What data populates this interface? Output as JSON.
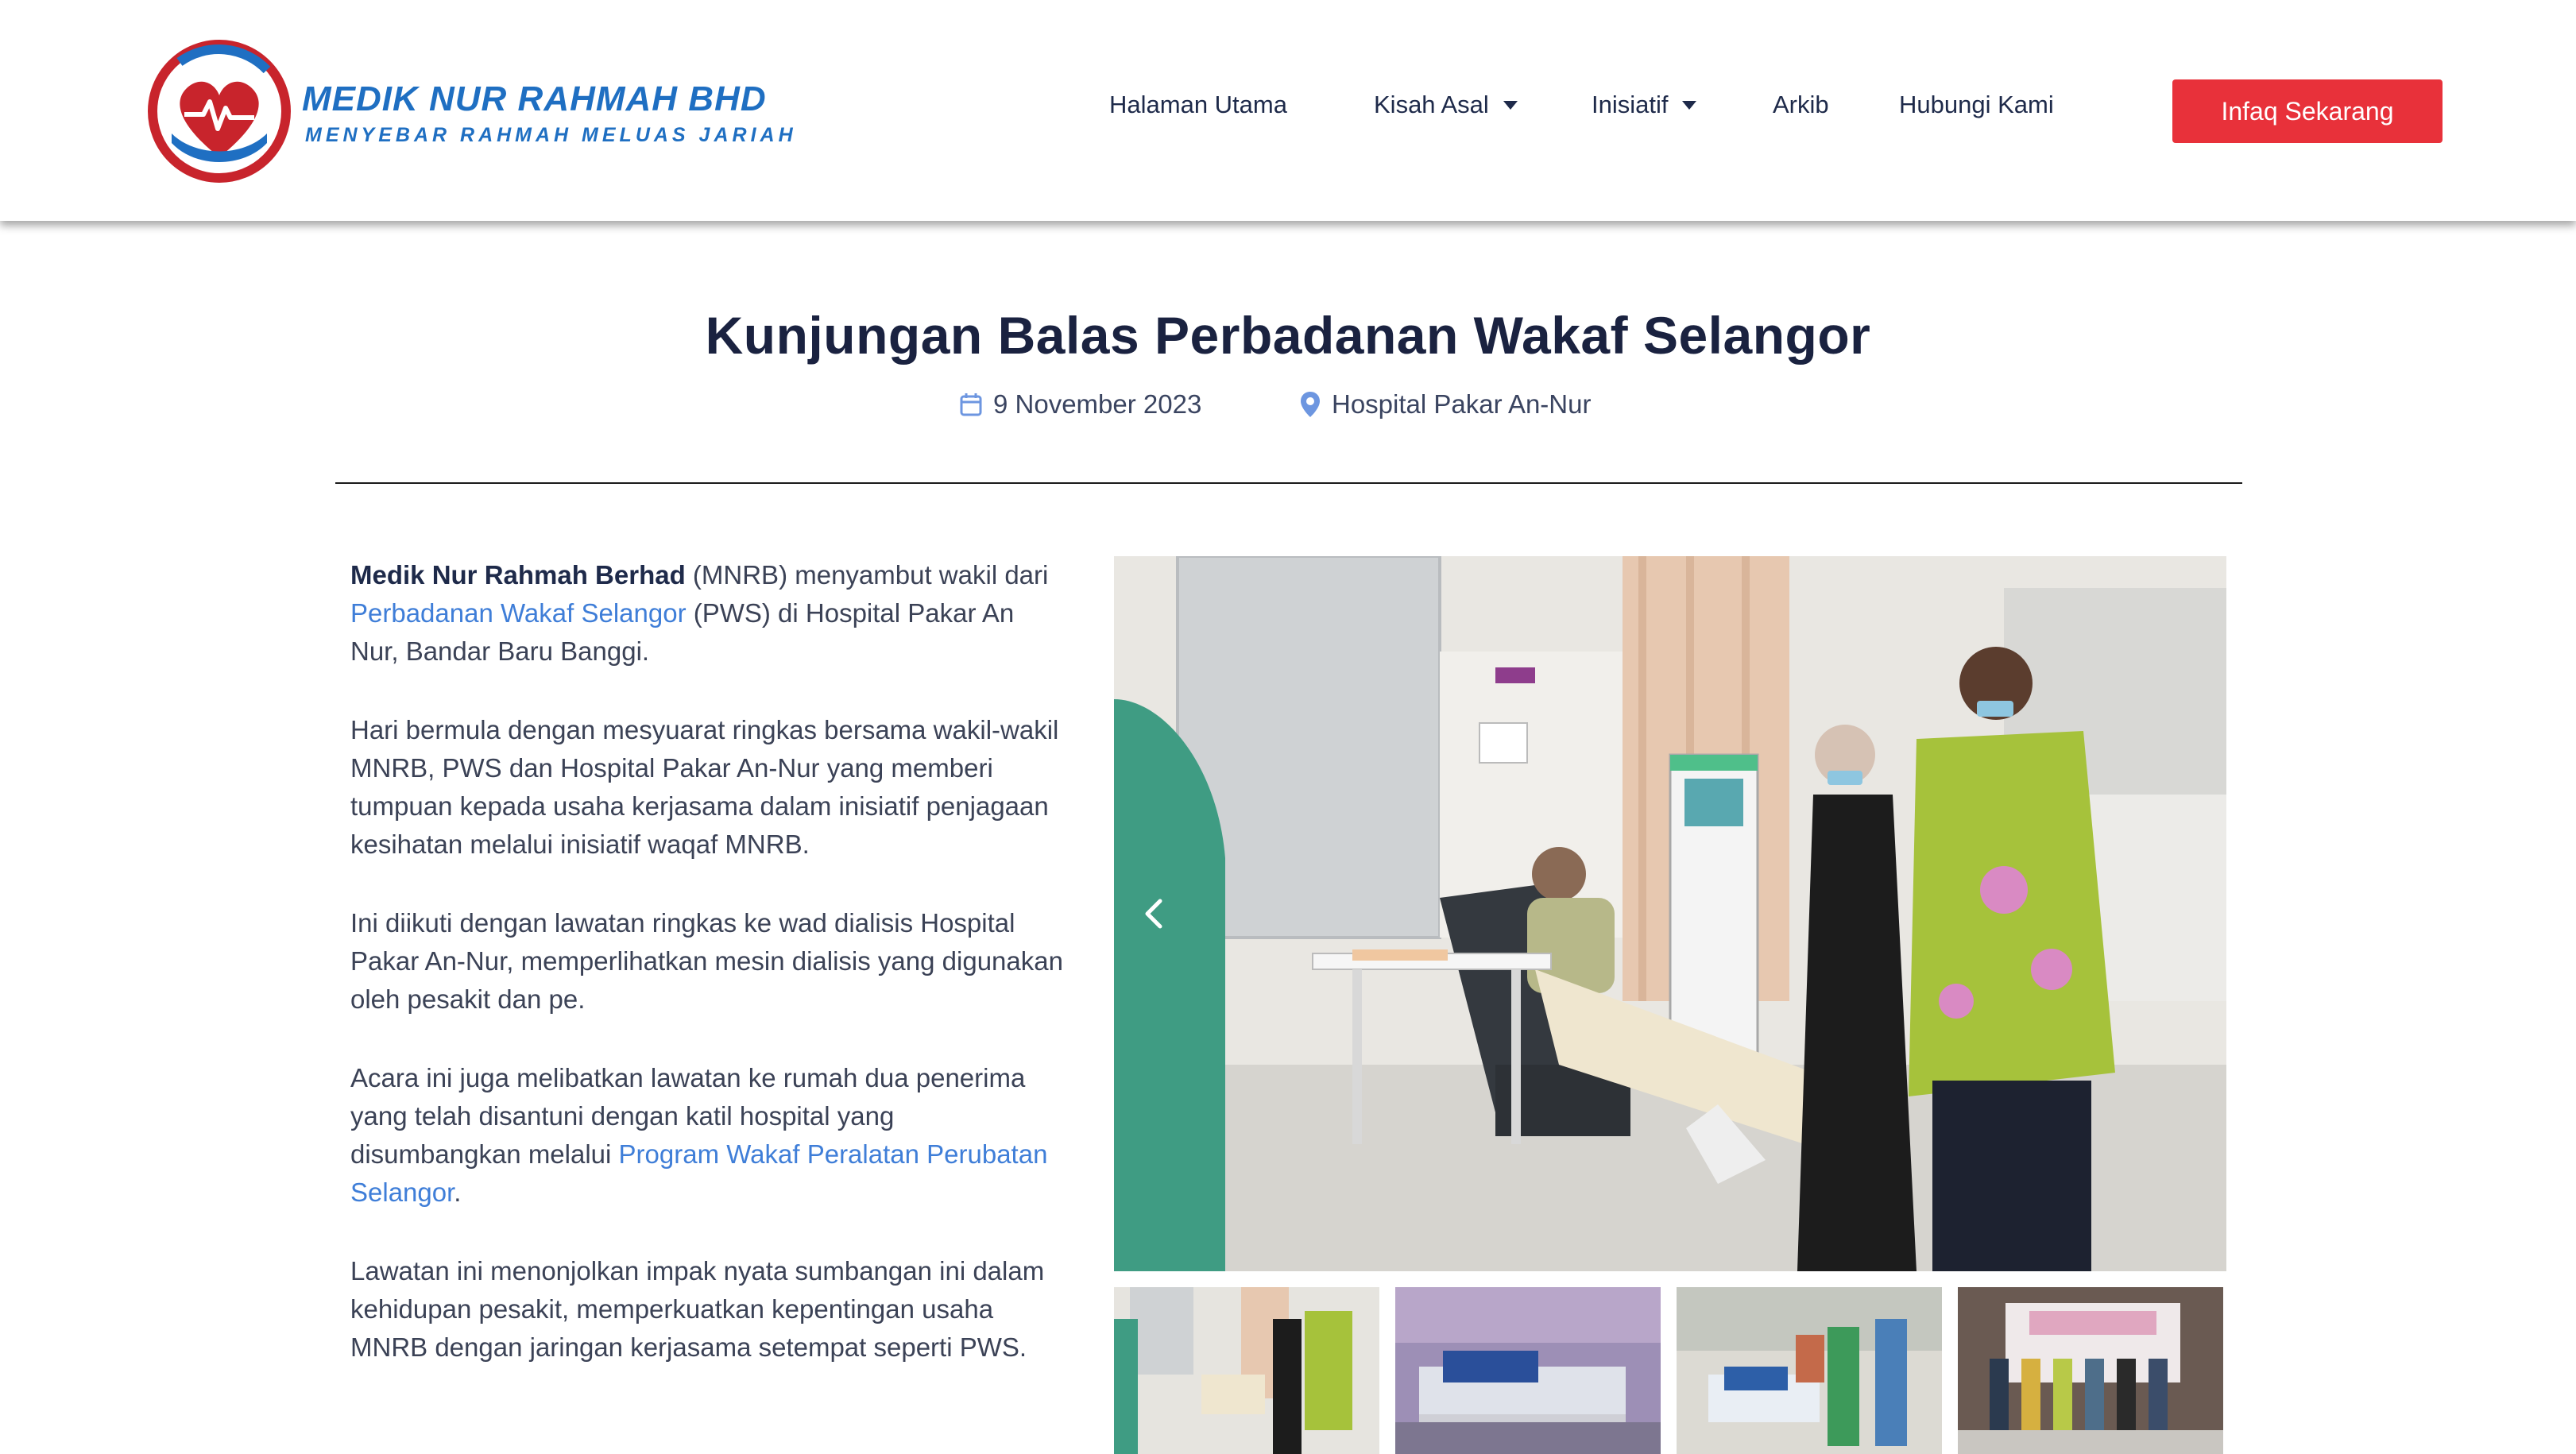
{
  "brand": {
    "name": "MEDIK NUR RAHMAH BHD",
    "tagline": "MENYEBAR RAHMAH MELUAS JARIAH",
    "colors": {
      "primary_blue": "#1f6fc2",
      "heart_red": "#c8242c",
      "cta_red": "#e8313a",
      "navy": "#1a2240",
      "link_blue": "#3f7ed8"
    }
  },
  "nav": {
    "items": [
      {
        "label": "Halaman Utama",
        "dropdown": false
      },
      {
        "label": "Kisah Asal",
        "dropdown": true
      },
      {
        "label": "Inisiatif",
        "dropdown": true
      },
      {
        "label": "Arkib",
        "dropdown": false
      },
      {
        "label": "Hubungi Kami",
        "dropdown": false
      }
    ],
    "cta_label": "Infaq Sekarang"
  },
  "post": {
    "title": "Kunjungan Balas Perbadanan Wakaf Selangor",
    "date": "9 November 2023",
    "location": "Hospital Pakar An-Nur",
    "date_icon": "calendar-icon",
    "location_icon": "map-pin-icon"
  },
  "article": {
    "p1": {
      "bold": "Medik Nur Rahmah Berhad",
      "t1": " (MNRB) menyambut wakil dari ",
      "link": "Perbadanan Wakaf Selangor",
      "t2": " (PWS) di Hospital Pakar An Nur, Bandar Baru Banggi."
    },
    "p2": "Hari bermula dengan mesyuarat ringkas bersama wakil-wakil MNRB, PWS dan Hospital Pakar An-Nur yang memberi tumpuan kepada usaha kerjasama dalam inisiatif penjagaan kesihatan melalui inisiatif waqaf MNRB.",
    "p3": "Ini diikuti dengan lawatan ringkas ke wad dialisis Hospital Pakar An-Nur, memperlihatkan mesin dialisis yang digunakan oleh pesakit dan pe.",
    "p4": {
      "t1": "Acara ini juga melibatkan lawatan ke rumah dua penerima yang telah disantuni dengan katil hospital yang disumbangkan melalui ",
      "link": "Program Wakaf Peralatan Perubatan Selangor",
      "t2": "."
    },
    "p5": "Lawatan ini menonjolkan impak nyata sumbangan ini dalam kehidupan pesakit, memperkuatkan kepentingan usaha MNRB dengan jaringan kerjasama setempat seperti PWS."
  },
  "gallery": {
    "thumbnail_count": 4,
    "prev_icon": "chevron-left-icon"
  }
}
